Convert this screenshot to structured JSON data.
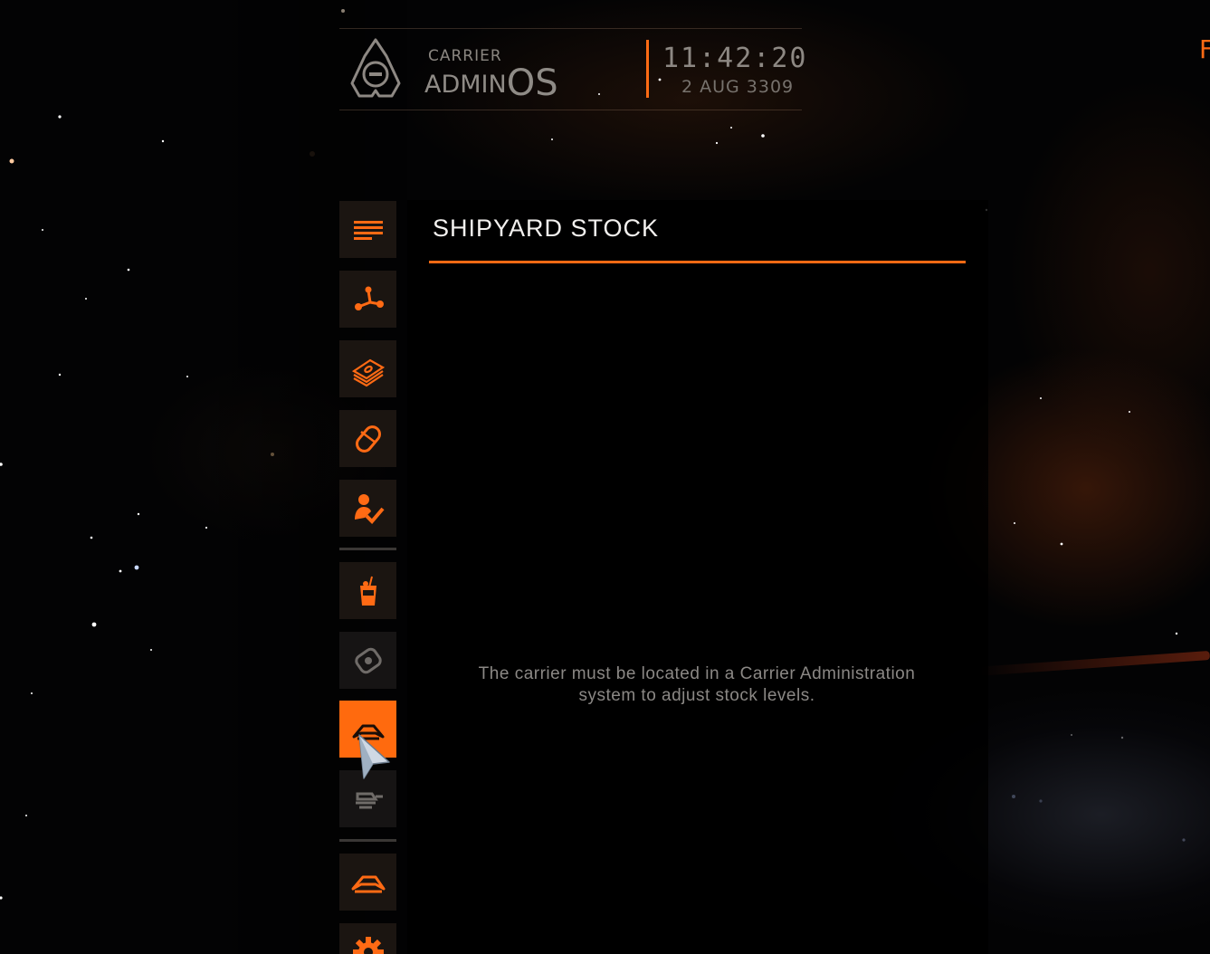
{
  "header": {
    "brand_top": "CARRIER",
    "brand_admin": "ADMIN",
    "brand_os": "OS",
    "time": "11:42:20",
    "date": "2 AUG 3309",
    "edge_letter": "F"
  },
  "sidebar": {
    "items": [
      {
        "name": "summary",
        "icon": "lines-icon",
        "state": "normal"
      },
      {
        "name": "navigation",
        "icon": "route-icon",
        "state": "normal"
      },
      {
        "name": "finance",
        "icon": "banknotes-icon",
        "state": "normal"
      },
      {
        "name": "tritium",
        "icon": "capsule-icon",
        "state": "normal"
      },
      {
        "name": "crew",
        "icon": "crew-check-icon",
        "state": "normal"
      },
      {
        "name": "bar",
        "icon": "drink-icon",
        "state": "normal"
      },
      {
        "name": "modules",
        "icon": "module-tag-icon",
        "state": "disabled"
      },
      {
        "name": "shipyard",
        "icon": "ship-icon",
        "state": "active"
      },
      {
        "name": "outfitting",
        "icon": "outfitting-icon",
        "state": "disabled"
      },
      {
        "name": "carrier",
        "icon": "carrier-icon",
        "state": "normal"
      },
      {
        "name": "settings",
        "icon": "gear-icon",
        "state": "normal"
      }
    ]
  },
  "main": {
    "title": "SHIPYARD STOCK",
    "notice_line1": "The carrier must be located in a Carrier Administration",
    "notice_line2": "system to adjust stock levels."
  },
  "colors": {
    "accent": "#ff6a14",
    "button_bg": "#1b1511",
    "active_bg": "#ff6a0e",
    "text_primary": "#f2f0ee",
    "text_muted": "#8b8885"
  }
}
